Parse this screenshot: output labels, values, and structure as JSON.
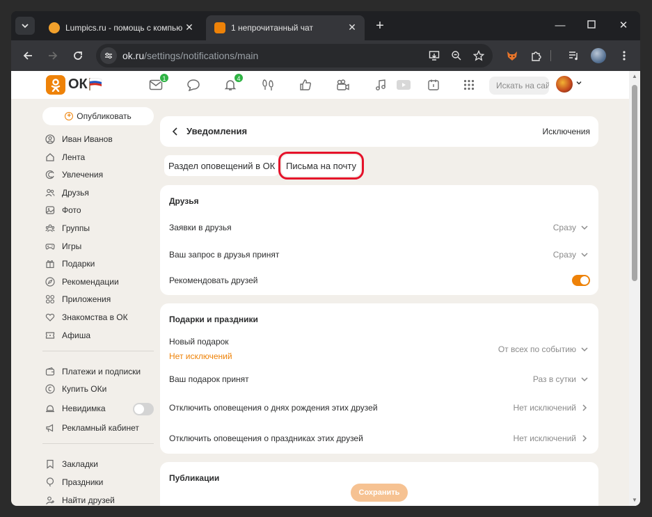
{
  "browser": {
    "tabs": [
      {
        "title": "Lumpics.ru - помощь с компьютером",
        "active": false,
        "favicon_color": "#f2a12c"
      },
      {
        "title": "1 непрочитанный чат",
        "active": true,
        "favicon_color": "#ee8208"
      }
    ],
    "url_host": "ok.ru",
    "url_path": "/settings/notifications/main"
  },
  "topnav": {
    "logo_text": "ОК",
    "badges": {
      "messages": "1",
      "notifications": "4"
    },
    "search_placeholder": "Искать на сайте"
  },
  "sidebar": {
    "publish_label": "Опубликовать",
    "group1": [
      {
        "label": "Иван Иванов",
        "icon": "user-icon"
      },
      {
        "label": "Лента",
        "icon": "home-icon"
      },
      {
        "label": "Увлечения",
        "icon": "hobby-icon"
      },
      {
        "label": "Друзья",
        "icon": "friends-icon"
      },
      {
        "label": "Фото",
        "icon": "photo-icon"
      },
      {
        "label": "Группы",
        "icon": "groups-icon"
      },
      {
        "label": "Игры",
        "icon": "gamepad-icon"
      },
      {
        "label": "Подарки",
        "icon": "gift-icon"
      },
      {
        "label": "Рекомендации",
        "icon": "compass-icon"
      },
      {
        "label": "Приложения",
        "icon": "apps-icon"
      },
      {
        "label": "Знакомства в ОК",
        "icon": "dating-icon"
      },
      {
        "label": "Афиша",
        "icon": "ticket-icon"
      }
    ],
    "group2": [
      {
        "label": "Платежи и подписки",
        "icon": "wallet-icon"
      },
      {
        "label": "Купить ОКи",
        "icon": "coin-icon"
      },
      {
        "label": "Невидимка",
        "icon": "invisible-icon",
        "toggle": false
      },
      {
        "label": "Рекламный кабинет",
        "icon": "megaphone-icon"
      }
    ],
    "group3": [
      {
        "label": "Закладки",
        "icon": "bookmark-icon"
      },
      {
        "label": "Праздники",
        "icon": "balloon-icon"
      },
      {
        "label": "Найти друзей",
        "icon": "add-friend-icon"
      }
    ]
  },
  "main": {
    "header_title": "Уведомления",
    "header_right": "Исключения",
    "tabs": [
      {
        "label": "Раздел оповещений в ОК",
        "selected": false
      },
      {
        "label": "Письма на почту",
        "selected": true
      }
    ],
    "friends_section": {
      "title": "Друзья",
      "rows": [
        {
          "label": "Заявки в друзья",
          "value": "Сразу"
        },
        {
          "label": "Ваш запрос в друзья принят",
          "value": "Сразу"
        },
        {
          "label": "Рекомендовать друзей",
          "toggle": true
        }
      ]
    },
    "gifts_section": {
      "title": "Подарки и праздники",
      "rows": [
        {
          "label": "Новый подарок",
          "sublabel": "Нет исключений",
          "value": "От всех по событию"
        },
        {
          "label": "Ваш подарок принят",
          "value": "Раз в сутки"
        },
        {
          "label": "Отключить оповещения о днях рождения этих друзей",
          "value": "Нет исключений"
        },
        {
          "label": "Отключить оповещения о праздниках этих друзей",
          "value": "Нет исключений"
        }
      ]
    },
    "publications_section": {
      "title": "Публикации"
    },
    "save_label": "Сохранить"
  },
  "colors": {
    "accent": "#ee8208",
    "highlight": "#e5122a",
    "badge": "#2fb344"
  }
}
